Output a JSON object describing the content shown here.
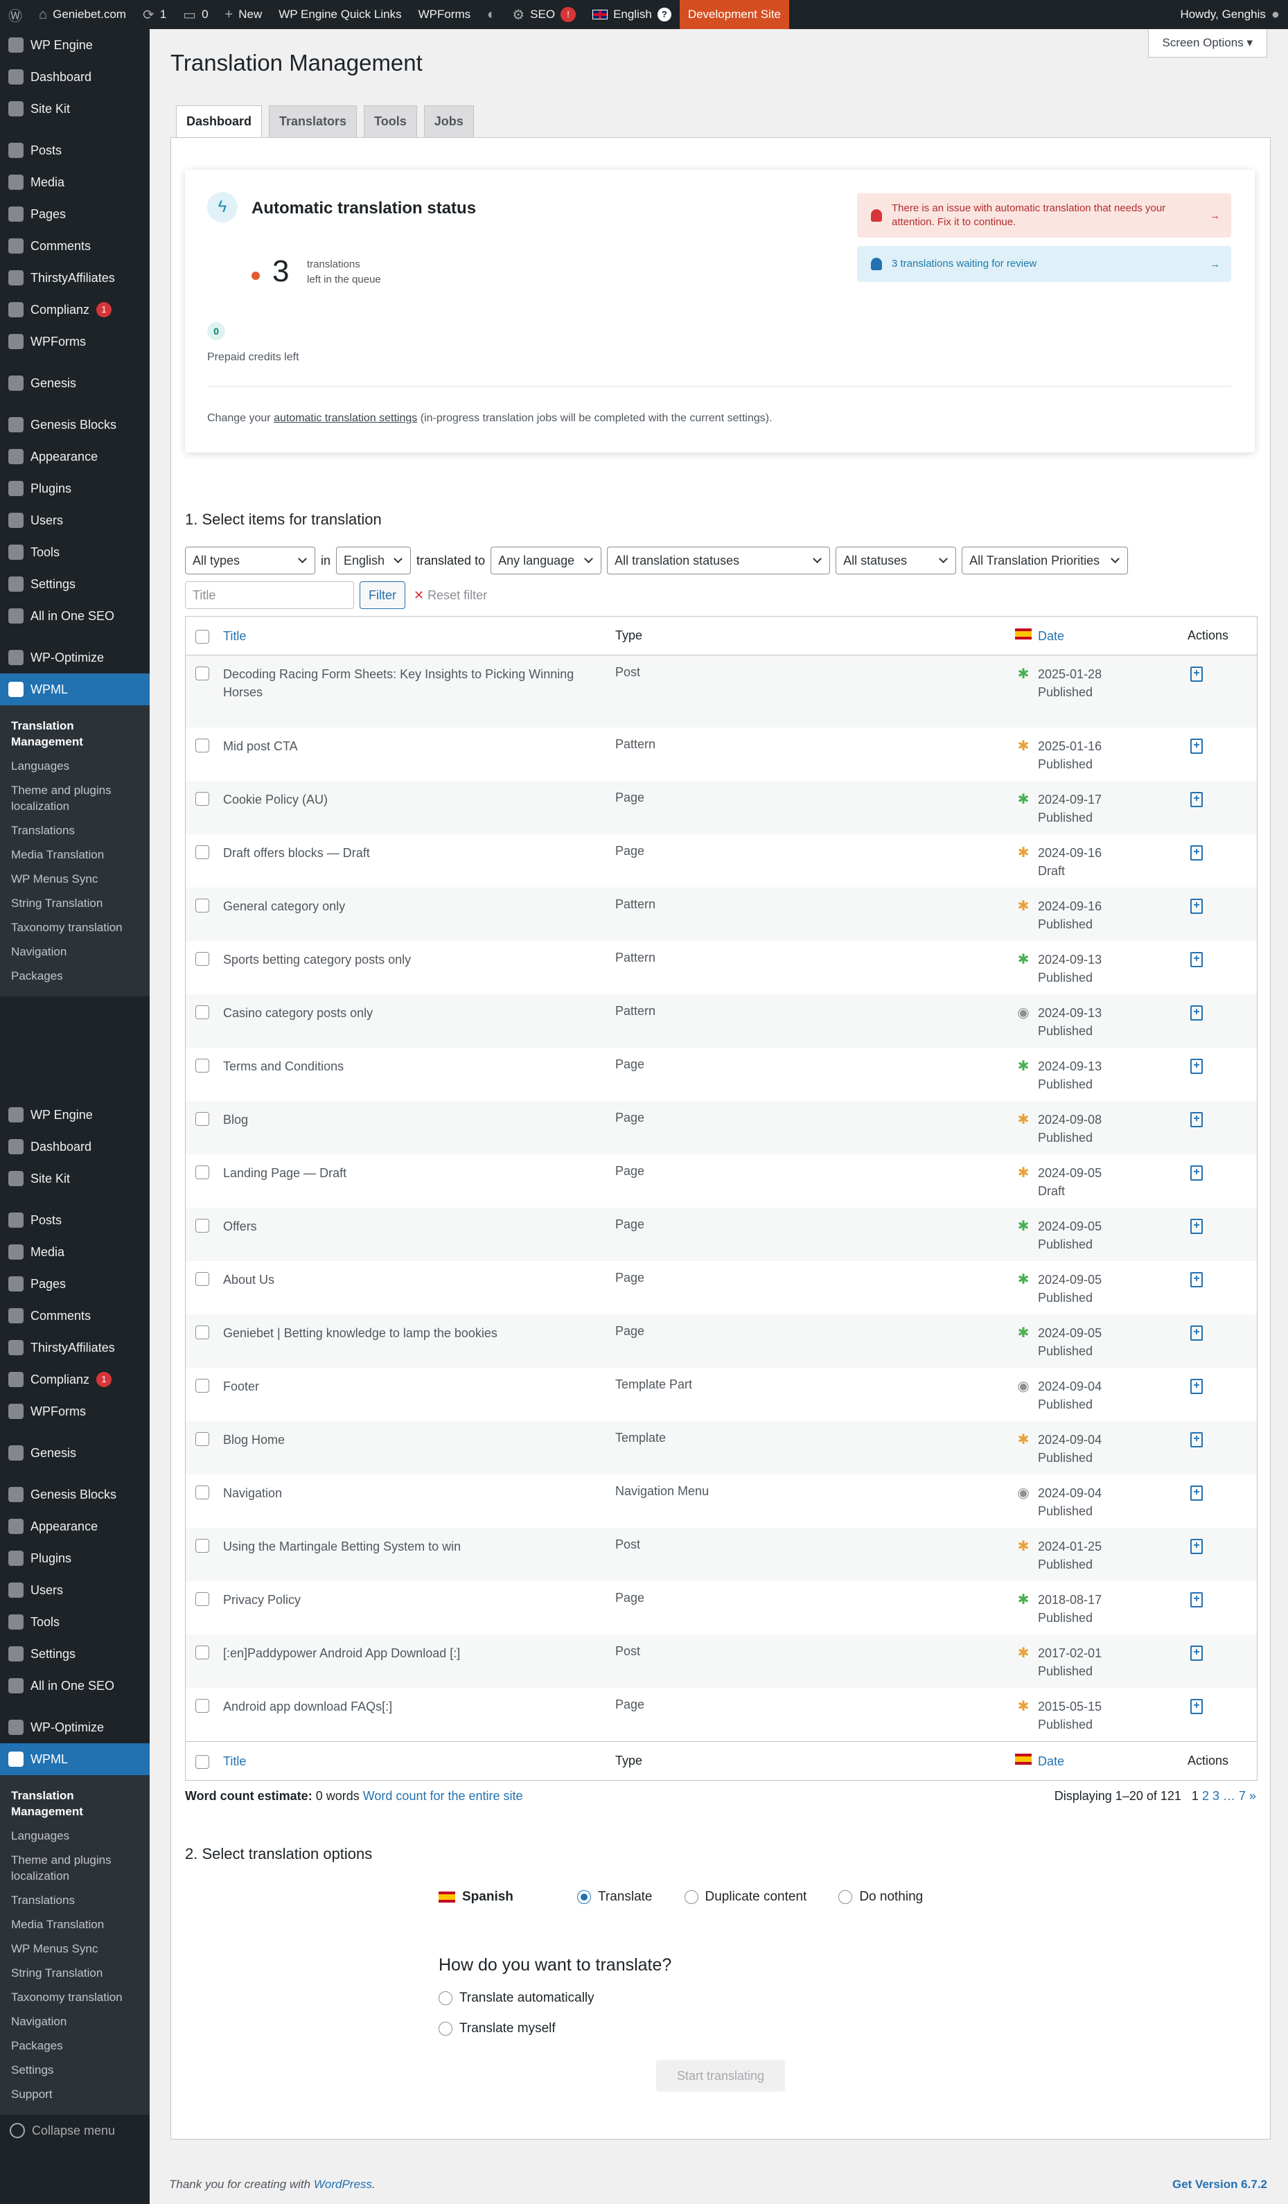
{
  "adminbar": {
    "site_name": "Geniebet.com",
    "updates_count": "1",
    "comments_count": "0",
    "new_label": "New",
    "quick_links": "WP Engine Quick Links",
    "wpforms": "WPForms",
    "seo_label": "SEO",
    "seo_badge": "!",
    "language": "English",
    "language_help": "?",
    "dev_site": "Development Site",
    "howdy": "Howdy, Genghis"
  },
  "sidebar": {
    "menu": [
      {
        "label": "WP Engine",
        "icon": "wpengine-icon"
      },
      {
        "label": "Dashboard",
        "icon": "dashboard-icon"
      },
      {
        "label": "Site Kit",
        "icon": "sitekit-icon"
      },
      {
        "sep": true
      },
      {
        "label": "Posts",
        "icon": "pin-icon"
      },
      {
        "label": "Media",
        "icon": "media-icon"
      },
      {
        "label": "Pages",
        "icon": "pages-icon"
      },
      {
        "label": "Comments",
        "icon": "comment-icon"
      },
      {
        "label": "ThirstyAffiliates",
        "icon": "ta-icon"
      },
      {
        "label": "Complianz",
        "icon": "check-icon",
        "badge": "1"
      },
      {
        "label": "WPForms",
        "icon": "form-icon"
      },
      {
        "sep": true
      },
      {
        "label": "Genesis",
        "icon": "genesis-icon"
      },
      {
        "sep": true
      },
      {
        "label": "Genesis Blocks",
        "icon": "blocks-icon"
      },
      {
        "label": "Appearance",
        "icon": "brush-icon"
      },
      {
        "label": "Plugins",
        "icon": "plugin-icon"
      },
      {
        "label": "Users",
        "icon": "user-icon"
      },
      {
        "label": "Tools",
        "icon": "wrench-icon"
      },
      {
        "label": "Settings",
        "icon": "settings-icon"
      },
      {
        "label": "All in One SEO",
        "icon": "aioseo-icon"
      },
      {
        "sep": true
      },
      {
        "label": "WP-Optimize",
        "icon": "optimize-icon"
      },
      {
        "label": "WPML",
        "icon": "wpml-icon",
        "active": true
      }
    ],
    "wpml_sub_first": [
      "Translation Management",
      "Languages",
      "Theme and plugins localization",
      "Translations",
      "Media Translation",
      "WP Menus Sync",
      "String Translation",
      "Taxonomy translation",
      "Navigation",
      "Packages"
    ],
    "wpml_sub_second": [
      "Translation Management",
      "Languages",
      "Theme and plugins localization",
      "Translations",
      "Media Translation",
      "WP Menus Sync",
      "String Translation",
      "Taxonomy translation",
      "Navigation",
      "Packages",
      "Settings",
      "Support"
    ],
    "collapse": "Collapse menu"
  },
  "screen_options": "Screen Options",
  "page_title": "Translation Management",
  "tabs": [
    "Dashboard",
    "Translators",
    "Tools",
    "Jobs"
  ],
  "status_card": {
    "title": "Automatic translation status",
    "queue_count": "3",
    "queue_line1": "translations",
    "queue_line2": "left in the queue",
    "credits": "0",
    "credits_label": "Prepaid credits left",
    "note_pre": "Change your ",
    "note_link": "automatic translation settings",
    "note_post": " (in-progress translation jobs will be completed with the current settings).",
    "alert_error": "There is an issue with automatic translation that needs your attention. Fix it to continue.",
    "alert_info": "3 translations waiting for review"
  },
  "section1_title": "1. Select items for translation",
  "filters": {
    "types": "All types",
    "in": "in",
    "language": "English",
    "translated_to": "translated to",
    "target": "Any language",
    "tstatus": "All translation statuses",
    "status": "All statuses",
    "priority": "All Translation Priorities",
    "title_placeholder": "Title",
    "filter_button": "Filter",
    "reset": "Reset filter"
  },
  "table": {
    "columns": {
      "title": "Title",
      "type": "Type",
      "date": "Date",
      "actions": "Actions"
    },
    "rows": [
      {
        "title": "Decoding Racing Form Sheets: Key Insights to Picking Winning Horses",
        "type": "Post",
        "date": "2025-01-28",
        "status": "Published",
        "icon": "g"
      },
      {
        "title": "Mid post CTA",
        "type": "Pattern",
        "date": "2025-01-16",
        "status": "Published",
        "icon": "o"
      },
      {
        "title": "Cookie Policy (AU)",
        "type": "Page",
        "date": "2024-09-17",
        "status": "Published",
        "icon": "g"
      },
      {
        "title": "Draft offers blocks — Draft",
        "type": "Page",
        "date": "2024-09-16",
        "status": "Draft",
        "icon": "o"
      },
      {
        "title": "General category only",
        "type": "Pattern",
        "date": "2024-09-16",
        "status": "Published",
        "icon": "o"
      },
      {
        "title": "Sports betting category posts only",
        "type": "Pattern",
        "date": "2024-09-13",
        "status": "Published",
        "icon": "g"
      },
      {
        "title": "Casino category posts only",
        "type": "Pattern",
        "date": "2024-09-13",
        "status": "Published",
        "icon": "e"
      },
      {
        "title": "Terms and Conditions",
        "type": "Page",
        "date": "2024-09-13",
        "status": "Published",
        "icon": "g"
      },
      {
        "title": "Blog",
        "type": "Page",
        "date": "2024-09-08",
        "status": "Published",
        "icon": "o"
      },
      {
        "title": "Landing Page — Draft",
        "type": "Page",
        "date": "2024-09-05",
        "status": "Draft",
        "icon": "o"
      },
      {
        "title": "Offers",
        "type": "Page",
        "date": "2024-09-05",
        "status": "Published",
        "icon": "g"
      },
      {
        "title": "About Us",
        "type": "Page",
        "date": "2024-09-05",
        "status": "Published",
        "icon": "g"
      },
      {
        "title": "Geniebet | Betting knowledge to lamp the bookies",
        "type": "Page",
        "date": "2024-09-05",
        "status": "Published",
        "icon": "g"
      },
      {
        "title": "Footer",
        "type": "Template Part",
        "date": "2024-09-04",
        "status": "Published",
        "icon": "e"
      },
      {
        "title": "Blog Home",
        "type": "Template",
        "date": "2024-09-04",
        "status": "Published",
        "icon": "o"
      },
      {
        "title": "Navigation",
        "type": "Navigation Menu",
        "date": "2024-09-04",
        "status": "Published",
        "icon": "e"
      },
      {
        "title": "Using the Martingale Betting System to win",
        "type": "Post",
        "date": "2024-01-25",
        "status": "Published",
        "icon": "o"
      },
      {
        "title": "Privacy Policy",
        "type": "Page",
        "date": "2018-08-17",
        "status": "Published",
        "icon": "g"
      },
      {
        "title": "[:en]Paddypower Android App Download [:]",
        "type": "Post",
        "date": "2017-02-01",
        "status": "Published",
        "icon": "o"
      },
      {
        "title": "Android app download FAQs[:]",
        "type": "Page",
        "date": "2015-05-15",
        "status": "Published",
        "icon": "o"
      }
    ]
  },
  "word_count": {
    "label": "Word count estimate:",
    "value": "0 words",
    "link": "Word count for the entire site"
  },
  "pagination": {
    "displaying": "Displaying 1–20 of 121",
    "current": "1",
    "pages": "2 3 … 7 »"
  },
  "section2_title": "2. Select translation options",
  "options": {
    "language": "Spanish",
    "translate": "Translate",
    "duplicate": "Duplicate content",
    "nothing": "Do nothing"
  },
  "how": {
    "title": "How do you want to translate?",
    "auto": "Translate automatically",
    "myself": "Translate myself"
  },
  "start_button": "Start translating",
  "footer": {
    "thanks": "Thank you for creating with ",
    "wp": "WordPress",
    "dot": ".",
    "version": "Get Version 6.7.2"
  },
  "colors": {
    "accent": "#2271b1",
    "adminbar": "#1d2327",
    "dev": "#d54e21"
  }
}
